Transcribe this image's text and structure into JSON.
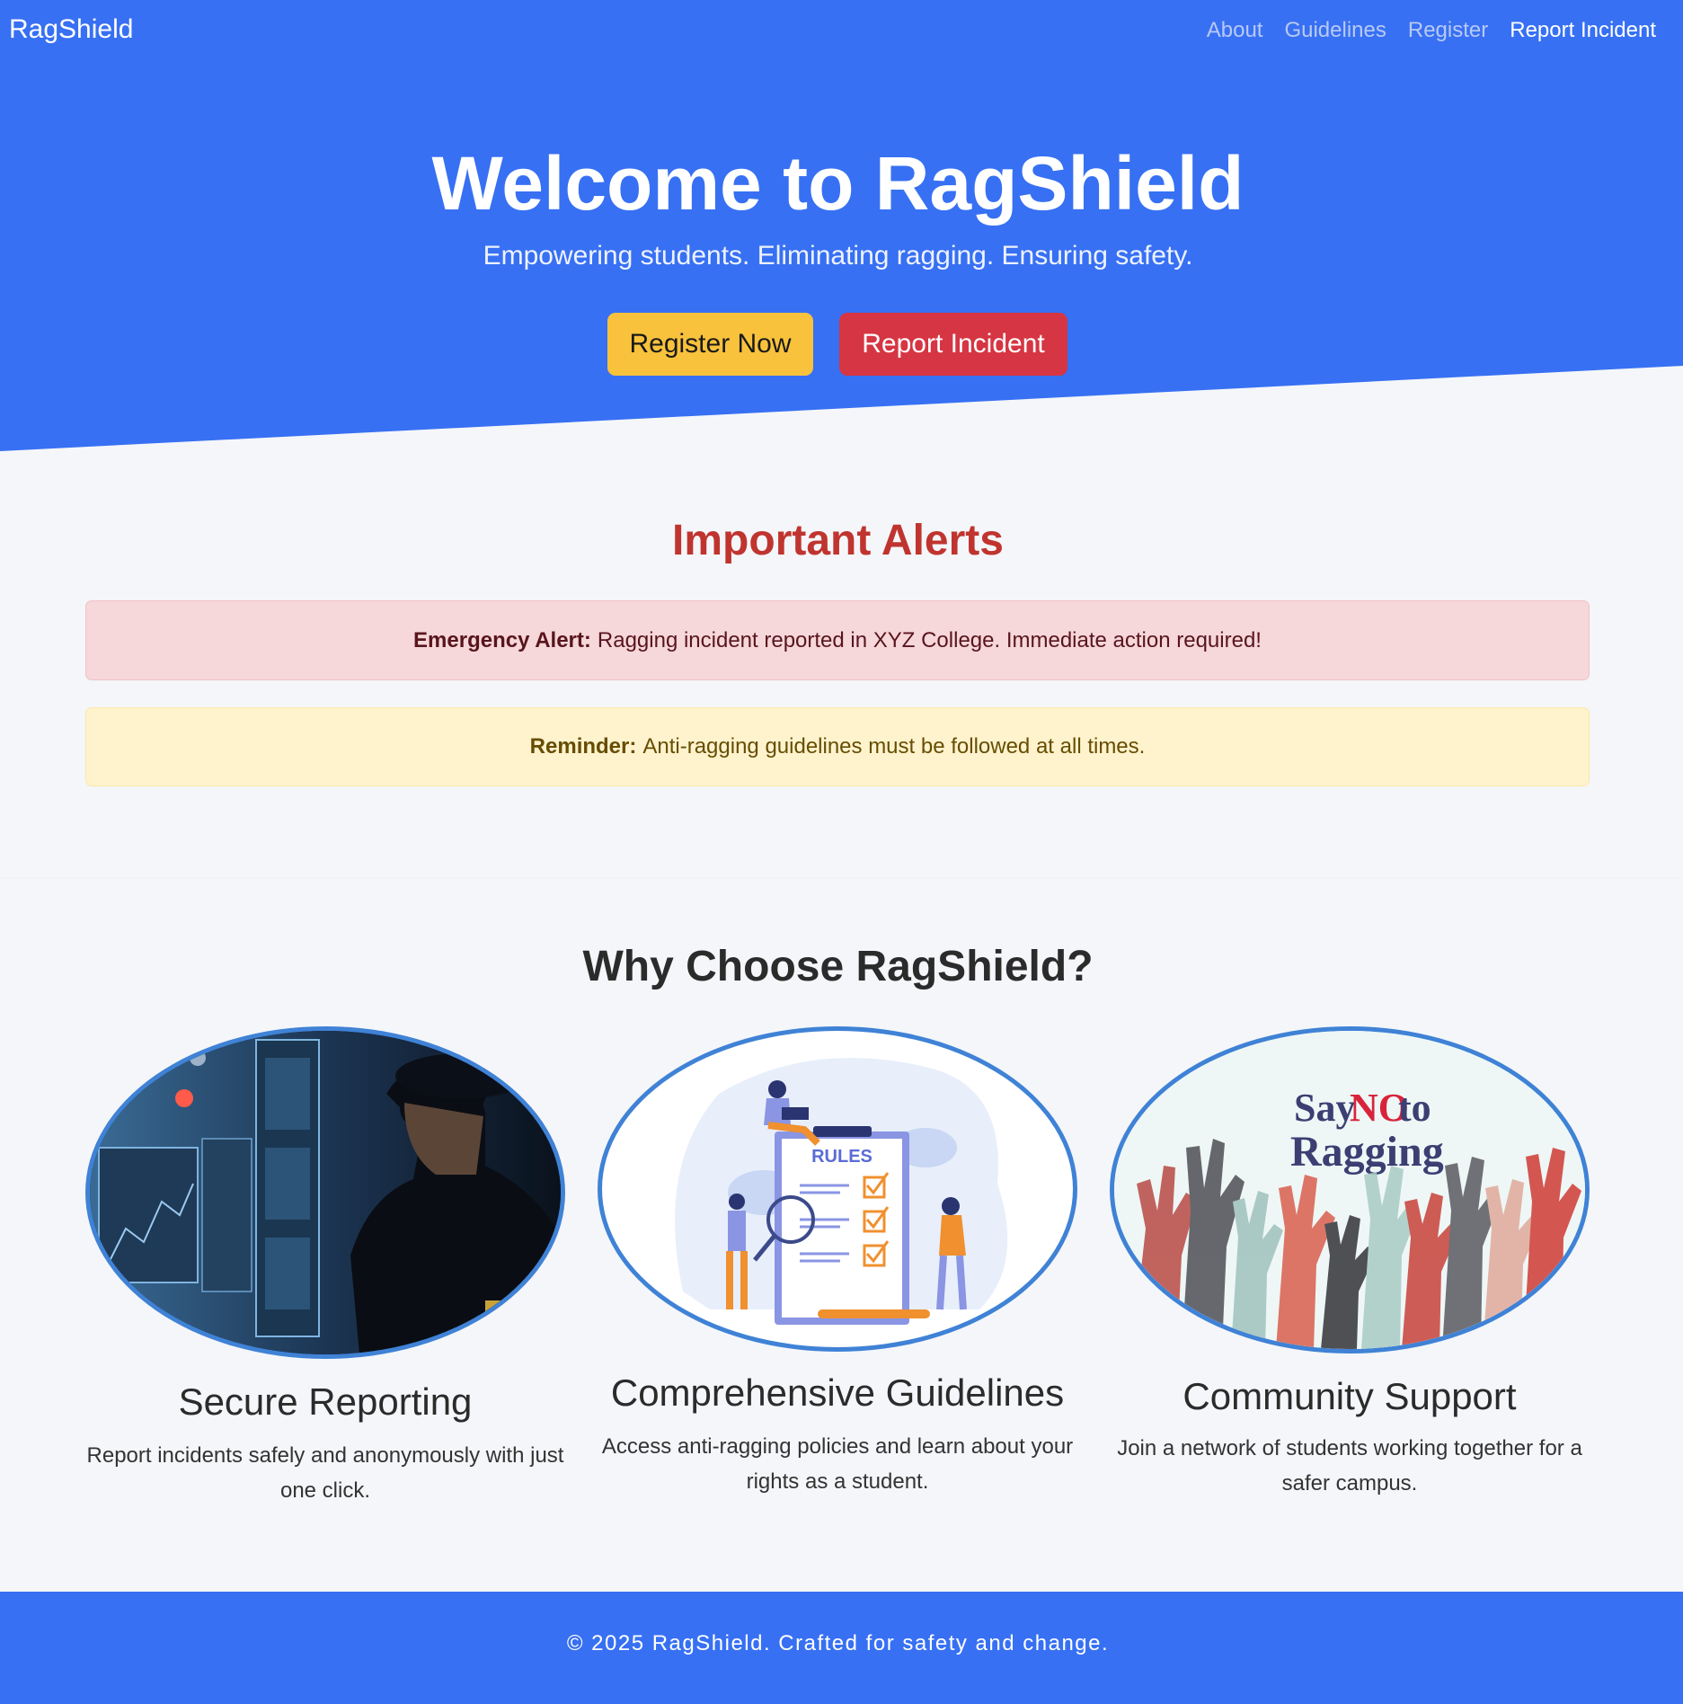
{
  "nav": {
    "brand": "RagShield",
    "links": [
      "About",
      "Guidelines",
      "Register",
      "Report Incident"
    ]
  },
  "hero": {
    "title": "Welcome to RagShield",
    "subtitle": "Empowering students. Eliminating ragging. Ensuring safety.",
    "register_label": "Register Now",
    "report_label": "Report Incident"
  },
  "alerts": {
    "title": "Important Alerts",
    "emergency": {
      "label": "Emergency Alert:",
      "text": "Ragging incident reported in XYZ College. Immediate action required!"
    },
    "reminder": {
      "label": "Reminder:",
      "text": "Anti-ragging guidelines must be followed at all times."
    }
  },
  "features": {
    "title": "Why Choose RagShield?",
    "items": [
      {
        "title": "Secure Reporting",
        "text": "Report incidents safely and anonymously with just one click."
      },
      {
        "title": "Comprehensive Guidelines",
        "text": "Access anti-ragging policies and learn about your rights as a student.",
        "image_text": "RULES"
      },
      {
        "title": "Community Support",
        "text": "Join a network of students working together for a safer campus.",
        "image_text": [
          "Say",
          "NO",
          "to",
          "Ragging"
        ]
      }
    ]
  },
  "footer": {
    "text": "© 2025 RagShield. Crafted for safety and change."
  },
  "colors": {
    "primary": "#3770f3",
    "warning_button": "#f8c23c",
    "danger_button": "#d63543",
    "alert_title": "#c0342f",
    "image_border": "#3f82d6"
  }
}
